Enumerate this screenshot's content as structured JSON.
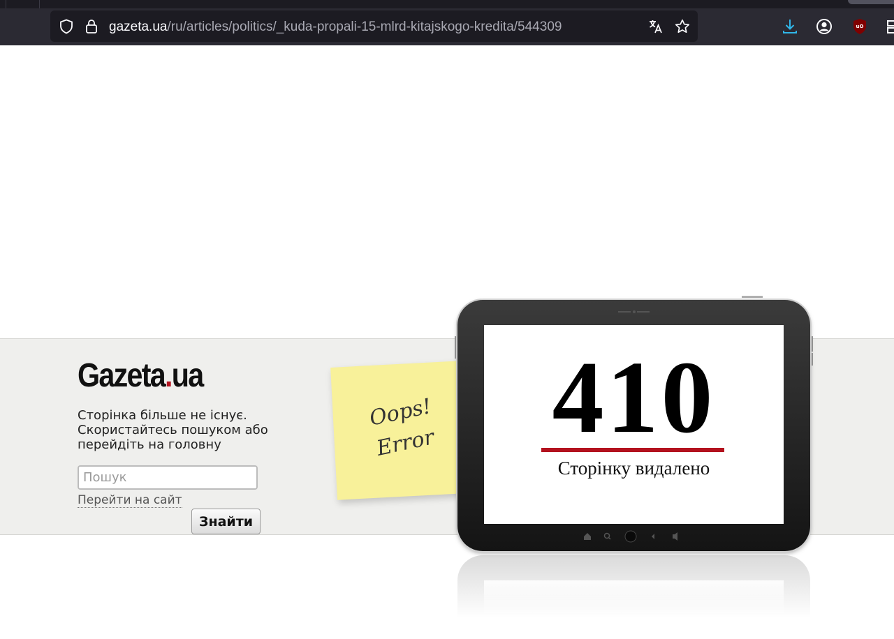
{
  "browser": {
    "url_host": "gazeta.ua",
    "url_path": "/ru/articles/politics/_kuda-propali-15-mlrd-kitajskogo-kredita/544309",
    "icons": [
      "shield-icon",
      "lock-icon",
      "translate-icon",
      "bookmark-star-icon",
      "download-icon",
      "account-icon",
      "ublock-icon",
      "extensions-icon"
    ],
    "colors": {
      "download_accent": "#30b6e9",
      "ublock": "#800000"
    }
  },
  "page": {
    "logo_main": "Gazeta",
    "logo_dot": ".",
    "logo_tld": "ua",
    "message_lines": [
      "Сторінка більше не існує.",
      "Скористайтесь пошуком або",
      "перейдіть на головну"
    ],
    "search_placeholder": "Пошук",
    "go_to_site": "Перейти на сайт",
    "find_button": "Знайти",
    "note_line1": "Oops!",
    "note_line2": "Error",
    "error_code": "410",
    "error_text": "Сторінку видалено",
    "colors": {
      "brand_red": "#b3121e",
      "band": "#efefed",
      "note": "#f8f19a"
    }
  }
}
